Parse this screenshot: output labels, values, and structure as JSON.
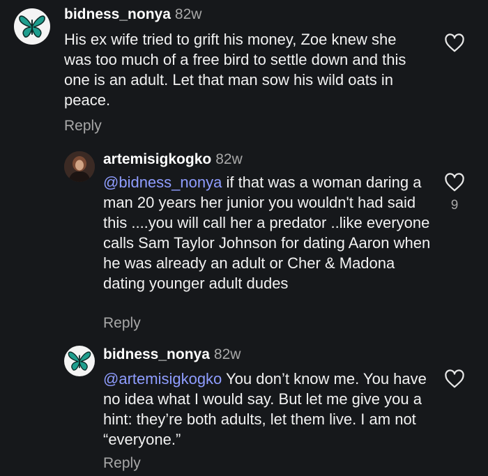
{
  "comments": [
    {
      "username": "bidness_nonya",
      "age": "82w",
      "mention": "",
      "text": "His ex wife tried to grift his money, Zoe knew she was too much of a free bird to settle down and this one is an adult. Let that man sow his wild oats in peace.",
      "reply_label": "Reply",
      "like_count": "",
      "avatar_icon": "butterfly-icon"
    },
    {
      "username": "artemisigkogko",
      "age": "82w",
      "mention": "@bidness_nonya",
      "text": " if that was a woman daring a man 20 years her junior you wouldn't had said this ....you will call her a predator ..like everyone calls Sam Taylor Johnson for dating Aaron when he was already an adult or Cher & Madona dating younger adult dudes",
      "reply_label": "Reply",
      "like_count": "9",
      "avatar_icon": "portrait-icon"
    },
    {
      "username": "bidness_nonya",
      "age": "82w",
      "mention": "@artemisigkogko",
      "text": " You don’t know me. You have no idea what I would say. But let me give you a hint: they’re both adults, let them live. I am not “everyone.”",
      "reply_label": "Reply",
      "like_count": "",
      "avatar_icon": "butterfly-icon"
    }
  ],
  "colors": {
    "background": "#16181b",
    "mention": "#8f9dff",
    "muted": "#a8a8a8",
    "butterfly": "#1e9e8e"
  }
}
